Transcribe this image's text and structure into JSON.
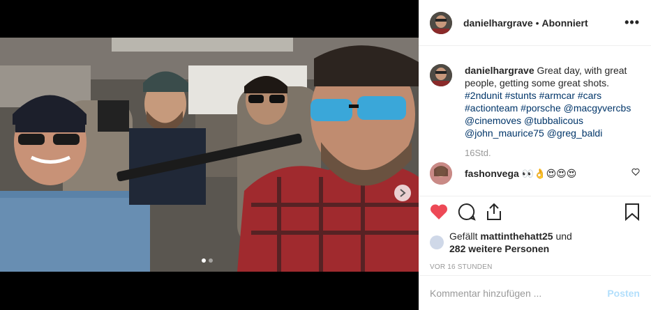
{
  "header": {
    "username": "danielhargrave",
    "separator": "•",
    "follow_status": "Abonniert",
    "more": "•••"
  },
  "caption": {
    "username": "danielhargrave",
    "text": " Great day, with great people, getting some great shots. ",
    "tags": "#2ndunit #stunts #armcar #cars #actionteam #porsche @macgyvercbs @cinemoves @tubbalicous @john_maurice75 @greg_baldi",
    "time": "16Std."
  },
  "reply": {
    "username": "fashonvega",
    "text": "👀👌😍😍😍"
  },
  "likes": {
    "prefix": "Gefällt ",
    "user": "mattinthehatt25",
    "mid": " und",
    "others": "282 weitere Personen"
  },
  "timestamp": "VOR 16 STUNDEN",
  "comment_box": {
    "placeholder": "Kommentar hinzufügen ...",
    "post_label": "Posten"
  },
  "carousel": {
    "current": 1,
    "total": 2
  },
  "colors": {
    "like_red": "#ed4956",
    "link_blue": "#003569",
    "post_btn": "#b2dffc"
  }
}
